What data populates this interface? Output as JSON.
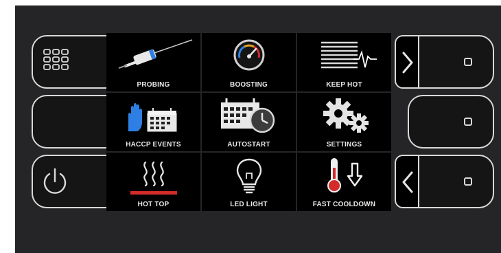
{
  "colors": {
    "panel_bg": "#252527",
    "tile_bg": "#000000",
    "border": "#d9d9d9",
    "text": "#e9e9e9",
    "accent_red": "#d32a2a",
    "accent_blue": "#2d7fe3"
  },
  "left_buttons": [
    {
      "icon": "grid-icon"
    },
    {
      "icon": ""
    },
    {
      "icon": "power-icon"
    }
  ],
  "tiles": [
    {
      "label": "PROBING",
      "icon": "probe-icon"
    },
    {
      "label": "BOOSTING",
      "icon": "gauge-icon"
    },
    {
      "label": "KEEP HOT",
      "icon": "keep-hot-icon"
    },
    {
      "label": "HACCP EVENTS",
      "icon": "glove-calendar-icon"
    },
    {
      "label": "AUTOSTART",
      "icon": "calendar-clock-icon"
    },
    {
      "label": "SETTINGS",
      "icon": "gears-icon"
    },
    {
      "label": "HOT TOP",
      "icon": "heat-waves-icon"
    },
    {
      "label": "LED LIGHT",
      "icon": "light-bulb-icon"
    },
    {
      "label": "FAST COOLDOWN",
      "icon": "thermometer-down-icon"
    }
  ],
  "right_buttons": [
    {
      "icon": "chevron-right-icon"
    },
    {
      "icon": ""
    },
    {
      "icon": "chevron-left-icon"
    }
  ]
}
